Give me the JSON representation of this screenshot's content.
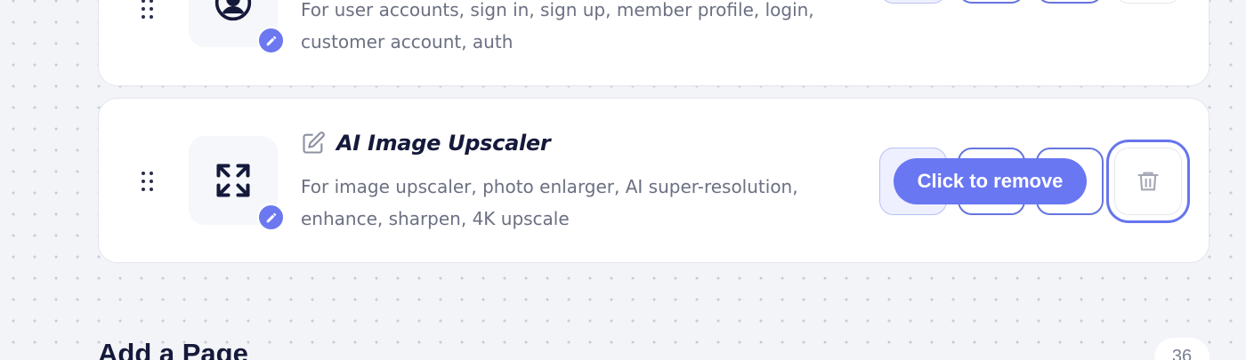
{
  "pages": [
    {
      "title": "",
      "description": "For user accounts, sign in, sign up, member profile, login, customer account, auth",
      "icon": "user-circle-icon"
    },
    {
      "title": "AI Image Upscaler",
      "description": "For image upscaler, photo enlarger, AI super-resolution, enhance, sharpen, 4K upscale",
      "icon": "expand-arrows-icon"
    }
  ],
  "tooltip": "Click to remove",
  "add_page": {
    "heading": "Add a Page",
    "count": "36"
  },
  "colors": {
    "accent": "#6a77f2",
    "text_dark": "#15193a",
    "text_muted": "#6b7082",
    "background": "#f3f4f7"
  }
}
